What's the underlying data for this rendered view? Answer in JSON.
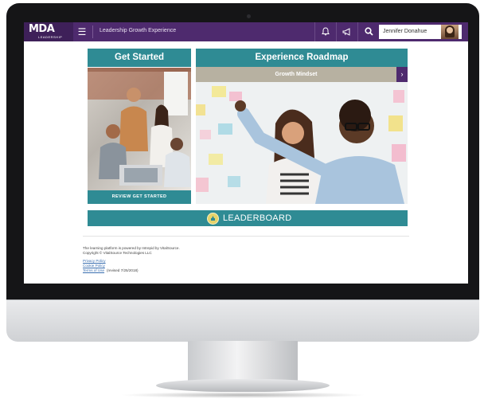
{
  "header": {
    "logo_text": "MDA",
    "logo_subtext": "LEADERSHIP",
    "menu_icon": "hamburger-menu-icon",
    "app_title": "Leadership Growth Experience",
    "icons": [
      "bell-icon",
      "megaphone-icon",
      "search-icon"
    ],
    "user_name": "Jennifer Donahue"
  },
  "cards": {
    "get_started": {
      "title": "Get Started",
      "button_label": "REVIEW GET STARTED"
    },
    "roadmap": {
      "title": "Experience Roadmap",
      "subtitle": "Growth Mindset",
      "next_icon": "chevron-right-icon"
    }
  },
  "leaderboard": {
    "label": "LEADERBOARD",
    "icon": "badge-icon"
  },
  "footer": {
    "powered_by": "The learning platform is powered by Intrepid by VitalSource.",
    "copyright": "Copyright © VitalSource Technologies LLC",
    "links": {
      "privacy": "Privacy Policy",
      "cookie": "Cookie Policy",
      "terms": "Terms of Use"
    },
    "revised": "(revised 7/25/2018)"
  },
  "colors": {
    "header_purple": "#4e2a6e",
    "teal": "#2f8b94",
    "tan": "#b7b1a1"
  }
}
